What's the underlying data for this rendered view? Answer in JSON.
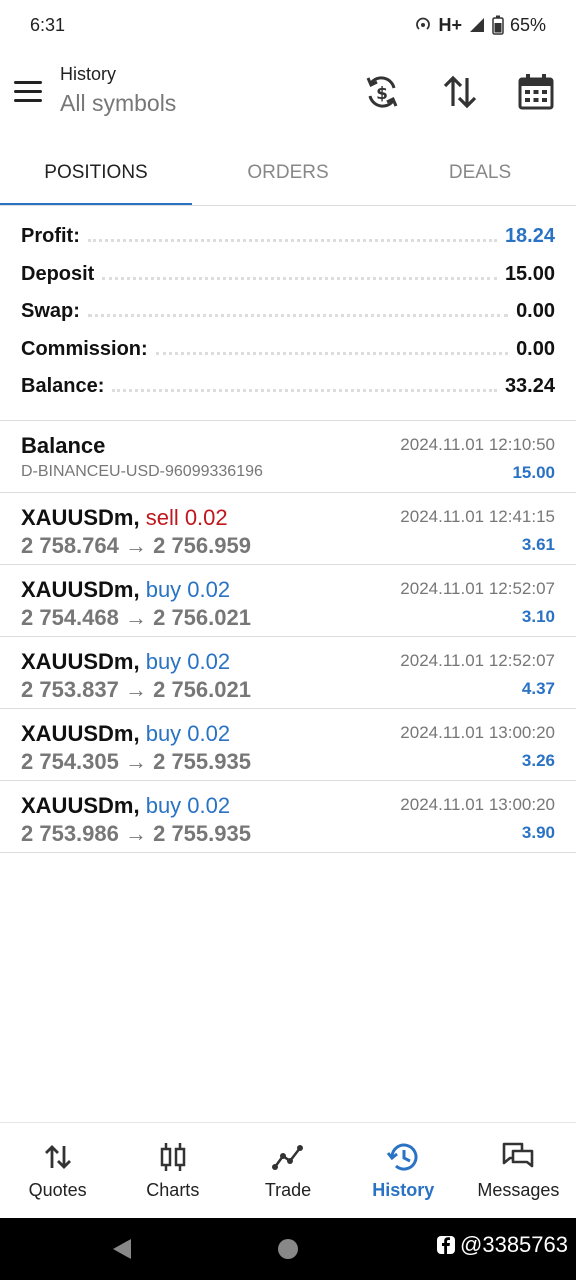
{
  "status_bar": {
    "time": "6:31",
    "network": "H+",
    "battery": "65%"
  },
  "header": {
    "title": "History",
    "subtitle": "All symbols"
  },
  "tabs": [
    {
      "label": "POSITIONS",
      "active": true
    },
    {
      "label": "ORDERS",
      "active": false
    },
    {
      "label": "DEALS",
      "active": false
    }
  ],
  "summary": [
    {
      "label": "Profit:",
      "value": "18.24"
    },
    {
      "label": "Deposit",
      "value": "15.00"
    },
    {
      "label": "Swap:",
      "value": "0.00"
    },
    {
      "label": "Commission:",
      "value": "0.00"
    },
    {
      "label": "Balance:",
      "value": "33.24"
    }
  ],
  "items": [
    {
      "title": "Balance",
      "subtitle": "D-BINANCEU-USD-96099336196",
      "date": "2024.11.01 12:10:50",
      "profit": "15.00"
    },
    {
      "title": "XAUUSDm,",
      "side": "sell 0.02",
      "prices": "2 758.764 → 2 756.959",
      "date": "2024.11.01 12:41:15",
      "profit": "3.61"
    },
    {
      "title": "XAUUSDm,",
      "side": "buy 0.02",
      "prices": "2 754.468 → 2 756.021",
      "date": "2024.11.01 12:52:07",
      "profit": "3.10"
    },
    {
      "title": "XAUUSDm,",
      "side": "buy 0.02",
      "prices": "2 753.837 → 2 756.021",
      "date": "2024.11.01 12:52:07",
      "profit": "4.37"
    },
    {
      "title": "XAUUSDm,",
      "side": "buy 0.02",
      "prices": "2 754.305 → 2 755.935",
      "date": "2024.11.01 13:00:20",
      "profit": "3.26"
    },
    {
      "title": "XAUUSDm,",
      "side": "buy 0.02",
      "prices": "2 753.986 → 2 755.935",
      "date": "2024.11.01 13:00:20",
      "profit": "3.90"
    }
  ],
  "bottom_nav": [
    {
      "label": "Quotes",
      "icon": "quotes-icon",
      "active": false
    },
    {
      "label": "Charts",
      "icon": "charts-icon",
      "active": false
    },
    {
      "label": "Trade",
      "icon": "trade-icon",
      "active": false
    },
    {
      "label": "History",
      "icon": "history-icon",
      "active": true
    },
    {
      "label": "Messages",
      "icon": "messages-icon",
      "active": false
    }
  ],
  "watermark": "@3385763",
  "colors": {
    "accent": "#2a72c4",
    "sell": "#c0171d",
    "muted": "#777777"
  }
}
